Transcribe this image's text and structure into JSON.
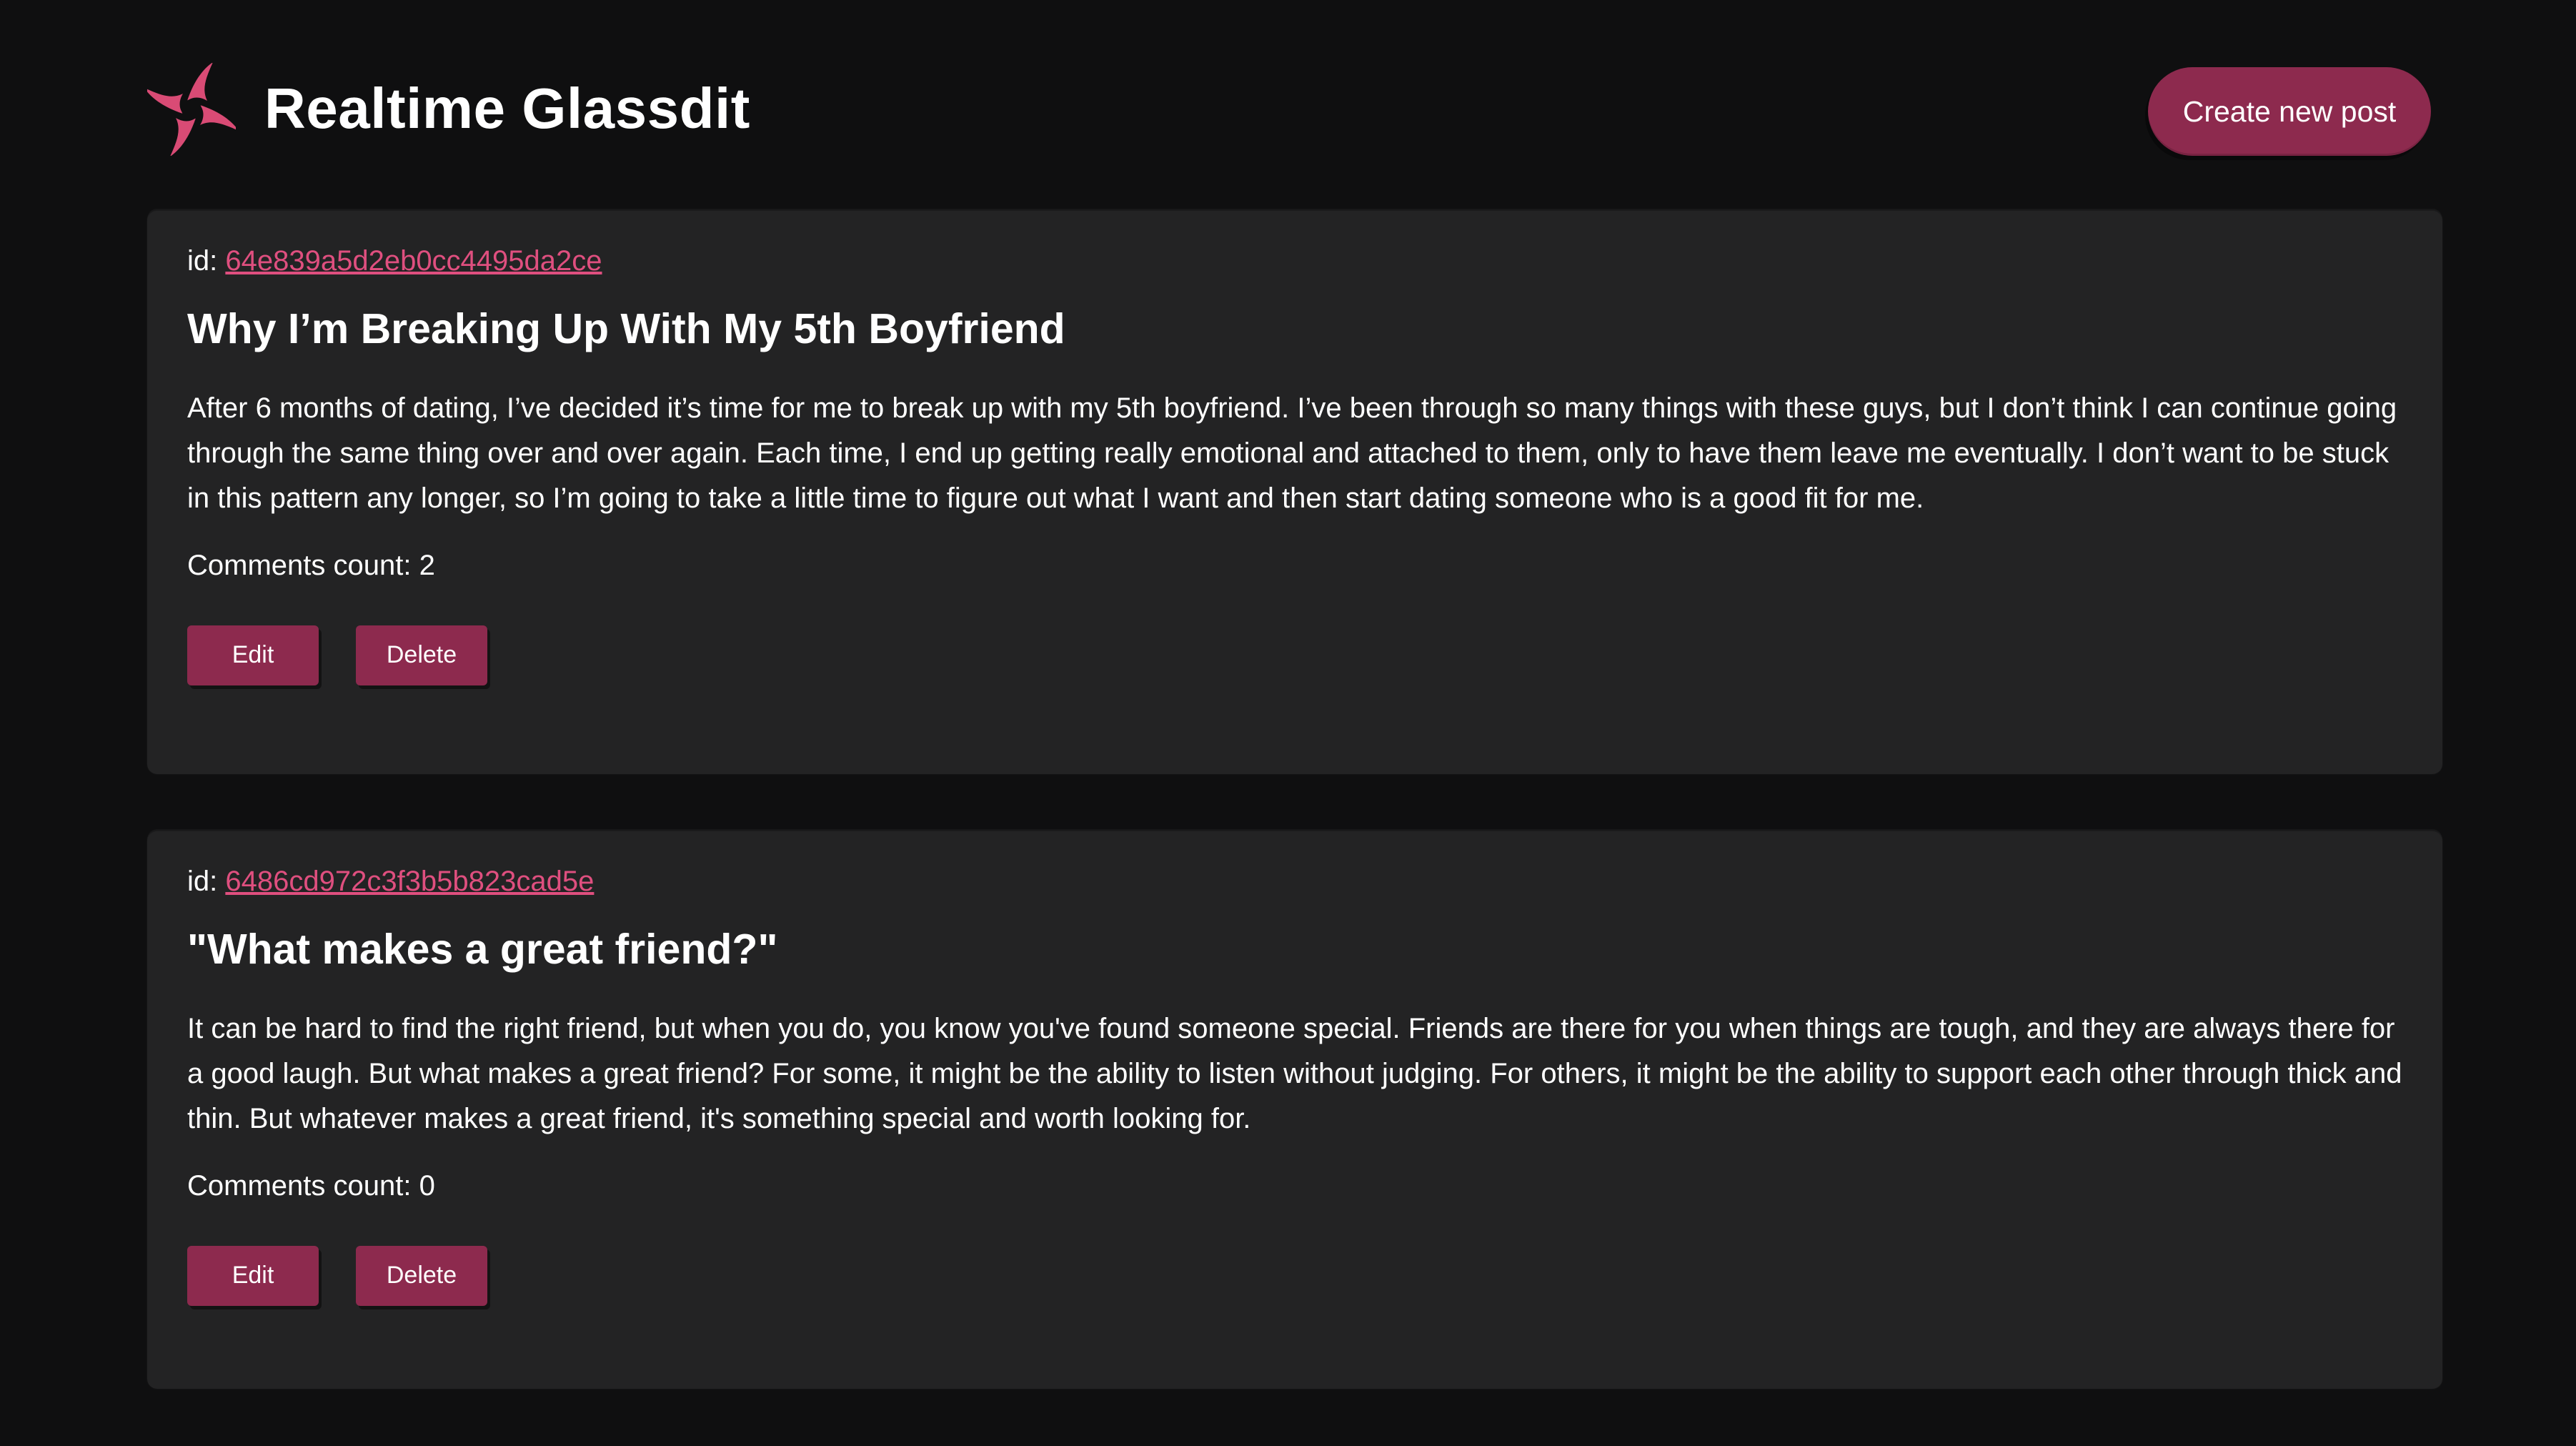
{
  "header": {
    "title": "Realtime Glassdit",
    "create_label": "Create new post",
    "logo_icon": "swirl-logo-icon"
  },
  "posts": [
    {
      "id_label": "id: ",
      "id": "64e839a5d2eb0cc4495da2ce",
      "title": "Why I’m Breaking Up With My 5th Boyfriend",
      "body": "After 6 months of dating, I’ve decided it’s time for me to break up with my 5th boyfriend. I’ve been through so many things with these guys, but I don’t think I can continue going through the same thing over and over again. Each time, I end up getting really emotional and attached to them, only to have them leave me eventually. I don’t want to be stuck in this pattern any longer, so I’m going to take a little time to figure out what I want and then start dating someone who is a good fit for me.",
      "comments": "Comments count: 2",
      "edit_label": "Edit",
      "delete_label": "Delete"
    },
    {
      "id_label": "id: ",
      "id": "6486cd972c3f3b5b823cad5e",
      "title": "\"What makes a great friend?\"",
      "body": "It can be hard to find the right friend, but when you do, you know you've found someone special. Friends are there for you when things are tough, and they are always there for a good laugh. But what makes a great friend? For some, it might be the ability to listen without judging. For others, it might be the ability to support each other through thick and thin. But whatever makes a great friend, it's something special and worth looking for.",
      "comments": "Comments count: 0",
      "edit_label": "Edit",
      "delete_label": "Delete"
    }
  ],
  "colors": {
    "background": "#0f0f10",
    "card": "#232324",
    "accent": "#8d2a4e",
    "link": "#df4f7f",
    "logo": "#d94b75"
  }
}
